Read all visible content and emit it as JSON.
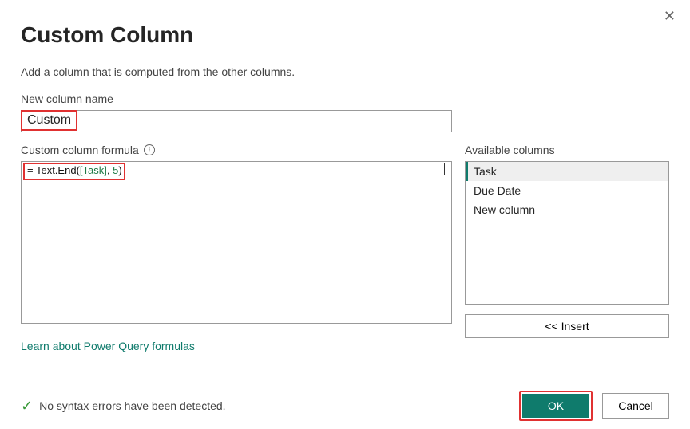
{
  "dialog": {
    "title": "Custom Column",
    "subtitle": "Add a column that is computed from the other columns.",
    "close_icon": "✕"
  },
  "name_field": {
    "label": "New column name",
    "value": "Custom"
  },
  "formula": {
    "label": "Custom column formula",
    "value": "= Text.End([Task], 5)",
    "parts": {
      "eq": "= ",
      "fn": "Text.End",
      "open": "(",
      "col": "[Task]",
      "comma": ", ",
      "num": "5",
      "close": ")"
    }
  },
  "available": {
    "label": "Available columns",
    "items": [
      "Task",
      "Due Date",
      "New column"
    ],
    "selected_index": 0,
    "insert_label": "<< Insert"
  },
  "learn_link": "Learn about Power Query formulas",
  "status": {
    "text": "No syntax errors have been detected."
  },
  "buttons": {
    "ok": "OK",
    "cancel": "Cancel"
  }
}
